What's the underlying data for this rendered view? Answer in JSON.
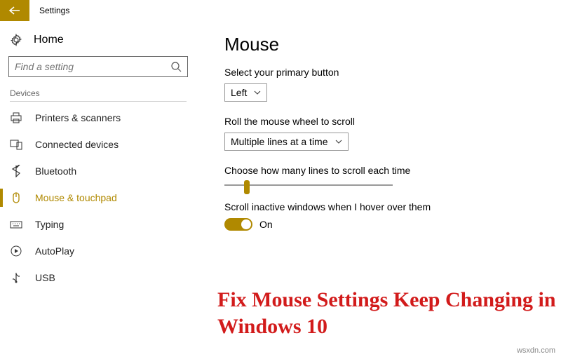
{
  "window": {
    "title": "Settings"
  },
  "sidebar": {
    "home": "Home",
    "search_placeholder": "Find a setting",
    "section": "Devices",
    "items": [
      {
        "label": "Printers & scanners"
      },
      {
        "label": "Connected devices"
      },
      {
        "label": "Bluetooth"
      },
      {
        "label": "Mouse & touchpad"
      },
      {
        "label": "Typing"
      },
      {
        "label": "AutoPlay"
      },
      {
        "label": "USB"
      }
    ]
  },
  "main": {
    "title": "Mouse",
    "primary_label": "Select your primary button",
    "primary_value": "Left",
    "wheel_label": "Roll the mouse wheel to scroll",
    "wheel_value": "Multiple lines at a time",
    "lines_label": "Choose how many lines to scroll each time",
    "inactive_label": "Scroll inactive windows when I hover over them",
    "toggle_state": "On"
  },
  "overlay": "Fix Mouse Settings Keep Changing in Windows 10",
  "watermark": "wsxdn.com",
  "colors": {
    "accent": "#b08900",
    "overlay": "#d21b1b"
  }
}
